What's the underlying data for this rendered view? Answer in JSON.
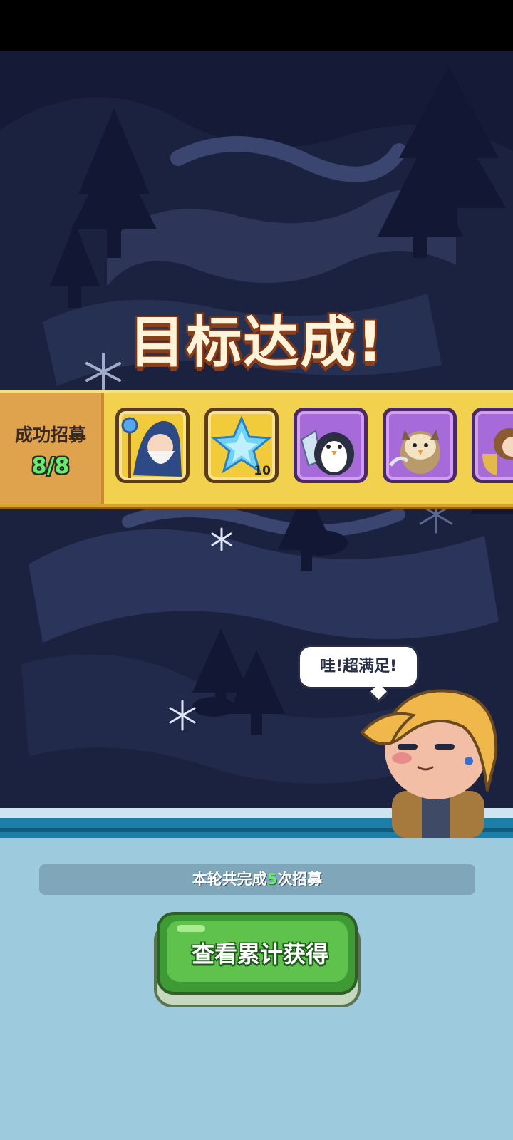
{
  "title": "目标达成!",
  "banner": {
    "label": "成功招募",
    "count": "8/8",
    "cards": [
      {
        "name": "wizard",
        "rarity": "gold",
        "count": ""
      },
      {
        "name": "ice-crystal",
        "rarity": "gold",
        "count": "10"
      },
      {
        "name": "penguin-knight",
        "rarity": "purple",
        "count": ""
      },
      {
        "name": "owl-warrior",
        "rarity": "purple",
        "count": ""
      },
      {
        "name": "bard",
        "rarity": "purple",
        "count": ""
      }
    ]
  },
  "speech": "哇!超满足!",
  "summary": {
    "prefix": "本轮共完成",
    "number": "5",
    "suffix": "次招募"
  },
  "button": {
    "label": "查看累计获得"
  },
  "colors": {
    "banner": "#f2d14e",
    "button": "#5ec24d",
    "panel": "#9dcadc",
    "highlight": "#67f06b"
  }
}
